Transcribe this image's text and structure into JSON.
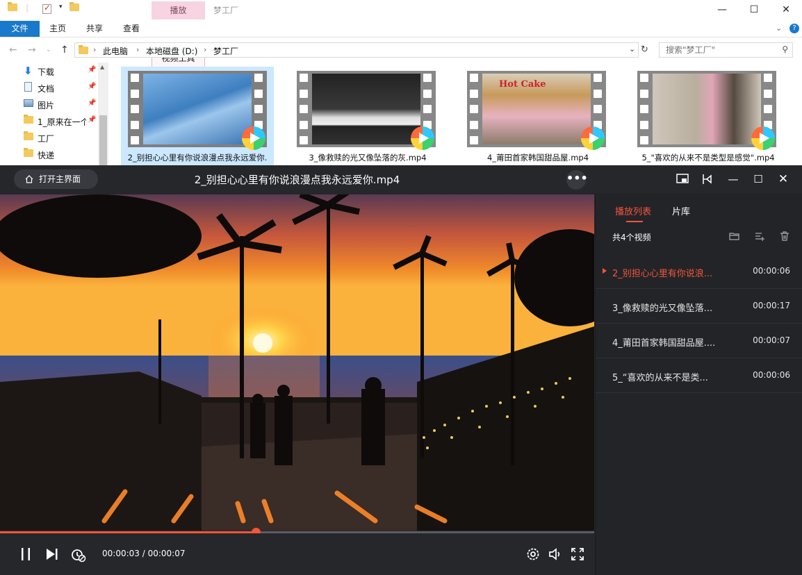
{
  "explorer": {
    "window_title": "梦工厂",
    "context_tab": "播放",
    "ribbon_tabs": [
      "文件",
      "主页",
      "共享",
      "查看",
      "视频工具"
    ],
    "breadcrumb": [
      "此电脑",
      "本地磁盘 (D:)",
      "梦工厂"
    ],
    "search_placeholder": "搜索\"梦工厂\"",
    "sidebar": [
      {
        "label": "下载",
        "icon": "download-icon",
        "pinned": true
      },
      {
        "label": "文档",
        "icon": "document-icon",
        "pinned": true
      },
      {
        "label": "图片",
        "icon": "picture-icon",
        "pinned": true
      },
      {
        "label": "1_原来在一个",
        "icon": "folder-icon",
        "pinned": true
      },
      {
        "label": "工厂",
        "icon": "folder-icon",
        "pinned": false
      },
      {
        "label": "快递",
        "icon": "folder-icon",
        "pinned": false
      }
    ],
    "files": [
      {
        "name": "2_别担心心里有你说浪漫点我永远爱你.",
        "selected": true
      },
      {
        "name": "3_像救赎的光又像坠落的灰.mp4",
        "selected": false
      },
      {
        "name": "4_莆田首家韩国甜品屋.mp4",
        "selected": false
      },
      {
        "name": "5_\"喜欢的从来不是类型是感觉\".mp4",
        "selected": false
      }
    ],
    "shop_sign": "Hot Cake"
  },
  "player": {
    "home_button": "打开主界面",
    "title": "2_别担心心里有你说浪漫点我永远爱你.mp4",
    "more_label": "•••",
    "time_display": "00:00:03 / 00:00:07",
    "progress": 0.43,
    "playlist": {
      "tabs": [
        "播放列表",
        "片库"
      ],
      "active_tab": 0,
      "count_label": "共4个视频",
      "items": [
        {
          "name": "2_别担心心里有你说浪...",
          "duration": "00:00:06",
          "active": true
        },
        {
          "name": "3_像救赎的光又像坠落...",
          "duration": "00:00:17",
          "active": false
        },
        {
          "name": "4_莆田首家韩国甜品屋....",
          "duration": "00:00:07",
          "active": false
        },
        {
          "name": "5_“喜欢的从来不是类...",
          "duration": "00:00:06",
          "active": false
        }
      ]
    },
    "accent_color": "#f5553b"
  }
}
